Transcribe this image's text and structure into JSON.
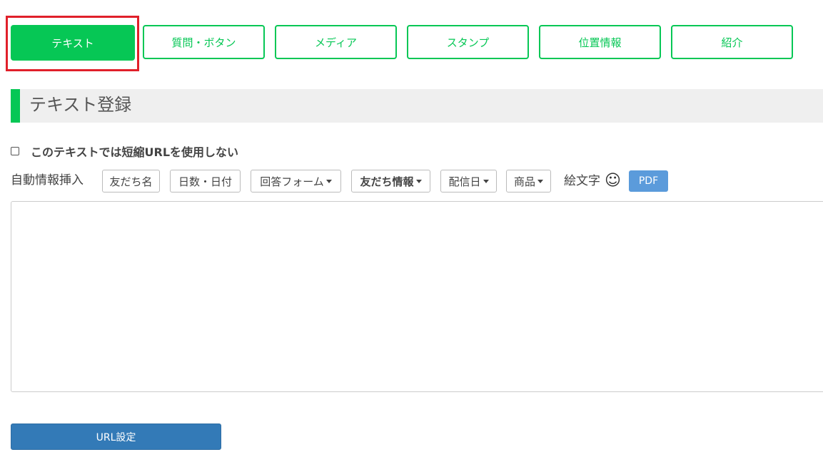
{
  "tabs": [
    {
      "label": "テキスト",
      "active": true
    },
    {
      "label": "質問・ボタン"
    },
    {
      "label": "メディア"
    },
    {
      "label": "スタンプ"
    },
    {
      "label": "位置情報"
    },
    {
      "label": "紹介"
    }
  ],
  "section": {
    "title": "テキスト登録"
  },
  "shorten_url": {
    "label": "このテキストでは短縮URLを使用しない",
    "checked": false
  },
  "insert": {
    "label": "自動情報挿入",
    "buttons": [
      {
        "label": "友だち名"
      },
      {
        "label": "日数・日付"
      },
      {
        "label": "回答フォーム"
      },
      {
        "label": "友だち情報"
      },
      {
        "label": "配信日"
      },
      {
        "label": "商品"
      }
    ],
    "emoji_label": "絵文字",
    "pdf_label": "PDF"
  },
  "message": {
    "value": "",
    "placeholder": ""
  },
  "url_button": {
    "label": "URL設定"
  },
  "colors": {
    "accent": "#06c755",
    "highlight": "#e0202a",
    "primary": "#337ab7",
    "pdf": "#5b9bdb"
  }
}
